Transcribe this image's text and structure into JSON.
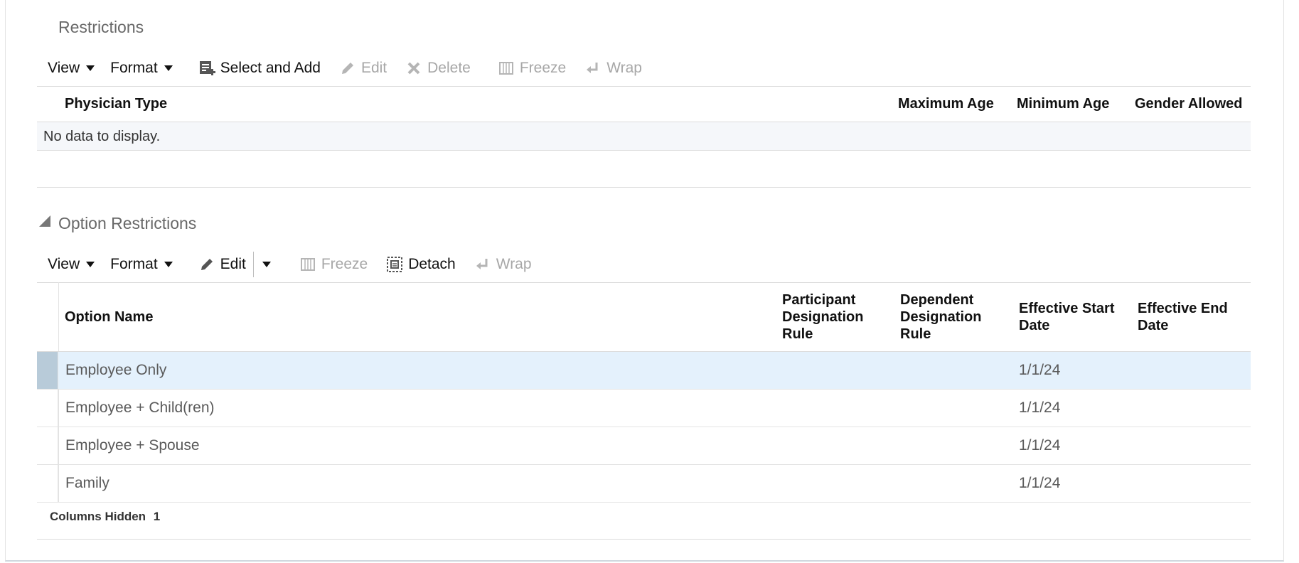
{
  "restrictions": {
    "title": "Restrictions",
    "toolbar": {
      "view": "View",
      "format": "Format",
      "select_and_add": "Select and Add",
      "edit": "Edit",
      "delete": "Delete",
      "freeze": "Freeze",
      "wrap": "Wrap"
    },
    "columns": [
      "Physician Type",
      "Maximum Age",
      "Minimum Age",
      "Gender Allowed"
    ],
    "empty_message": "No data to display."
  },
  "option_restrictions": {
    "title": "Option Restrictions",
    "toolbar": {
      "view": "View",
      "format": "Format",
      "edit": "Edit",
      "freeze": "Freeze",
      "detach": "Detach",
      "wrap": "Wrap"
    },
    "columns": {
      "option_name": "Option Name",
      "participant_rule": "Participant Designation Rule",
      "dependent_rule": "Dependent Designation Rule",
      "start_date": "Effective Start Date",
      "end_date": "Effective End Date"
    },
    "rows": [
      {
        "option_name": "Employee Only",
        "participant_rule": "",
        "dependent_rule": "",
        "start_date": "1/1/24",
        "end_date": "",
        "selected": true
      },
      {
        "option_name": "Employee + Child(ren)",
        "participant_rule": "",
        "dependent_rule": "",
        "start_date": "1/1/24",
        "end_date": ""
      },
      {
        "option_name": "Employee + Spouse",
        "participant_rule": "",
        "dependent_rule": "",
        "start_date": "1/1/24",
        "end_date": ""
      },
      {
        "option_name": "Family",
        "participant_rule": "",
        "dependent_rule": "",
        "start_date": "1/1/24",
        "end_date": ""
      }
    ],
    "footer": {
      "columns_hidden_label": "Columns Hidden",
      "columns_hidden_count": "1"
    }
  },
  "icons": {
    "select_and_add": "select-add-icon",
    "edit": "pencil-icon",
    "delete": "x-icon",
    "freeze": "freeze-icon",
    "wrap": "wrap-icon",
    "detach": "detach-icon"
  }
}
